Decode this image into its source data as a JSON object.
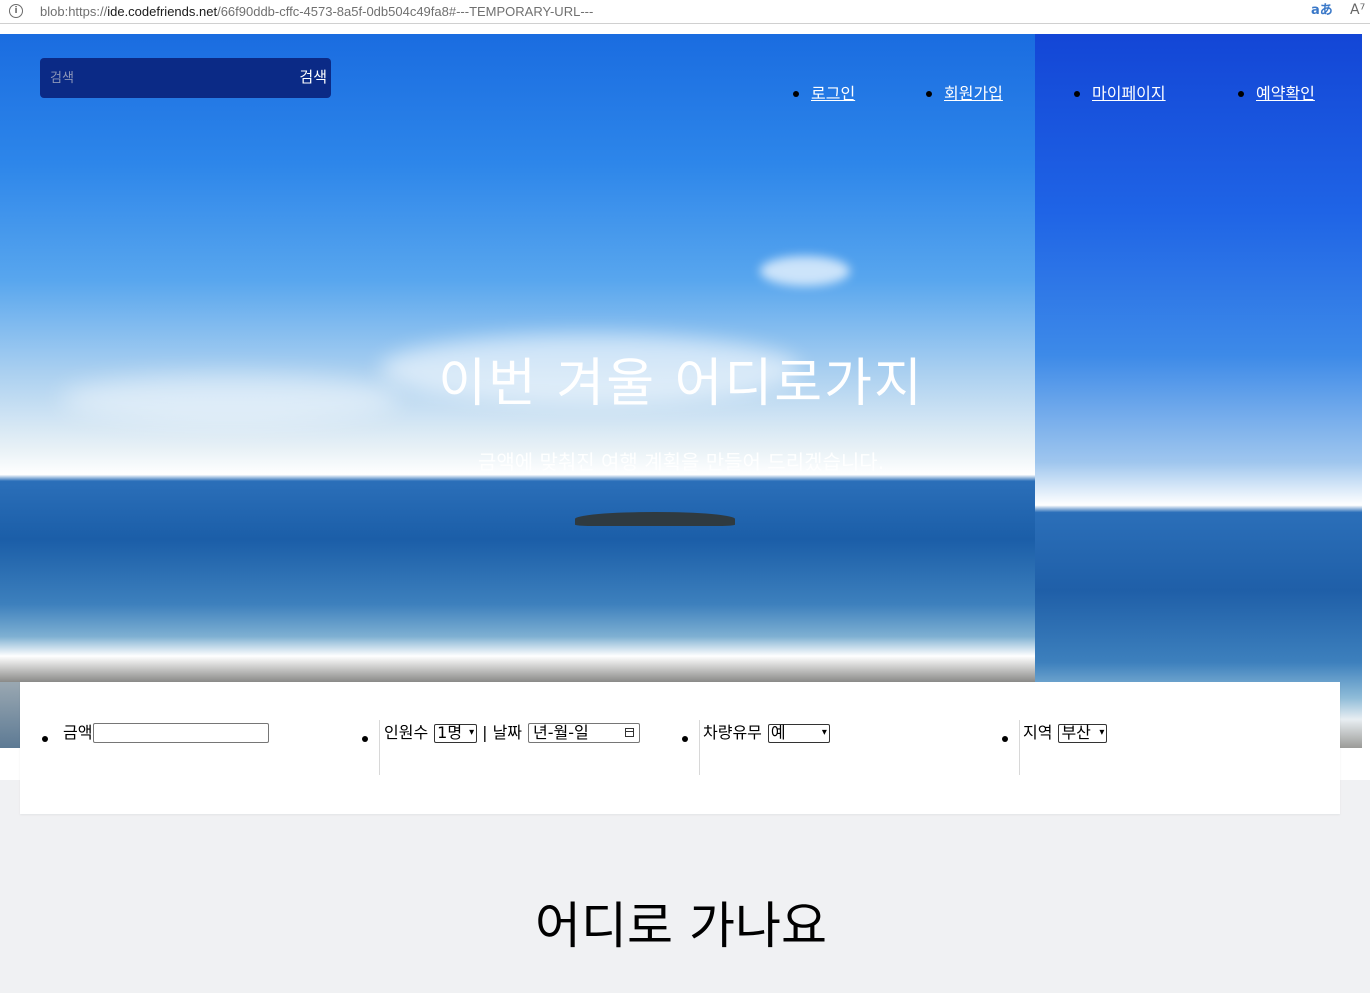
{
  "browser": {
    "url_prefix": "blob:https://",
    "url_host": "ide.codefriends.net",
    "url_rest": "/66f90ddb-cffc-4573-8a5f-0db504c49fa8#---TEMPORARY-URL---",
    "read_aloud_icon_text": "aあ",
    "font_icon_text": "A⁷"
  },
  "search": {
    "placeholder": "검색",
    "button_label": "검색"
  },
  "nav": {
    "items": [
      {
        "label": "로그인"
      },
      {
        "label": "회원가입"
      },
      {
        "label": "마이페이지"
      },
      {
        "label": "예약확인"
      }
    ]
  },
  "hero": {
    "title": "이번 겨울 어디로가지",
    "subtitle": "금액에 맞춰진 여행 계획을 만들어 드리겠습니다."
  },
  "filters": {
    "amount_label": "금액",
    "amount_value": "",
    "people_label": "인원수",
    "people_selected": "1명",
    "separator": "|",
    "date_label": "날짜",
    "date_placeholder": "년-월-일",
    "car_label": "차량유무",
    "car_selected": "예",
    "region_label": "지역",
    "region_selected": "부산"
  },
  "section": {
    "heading": "어디로 가나요"
  }
}
